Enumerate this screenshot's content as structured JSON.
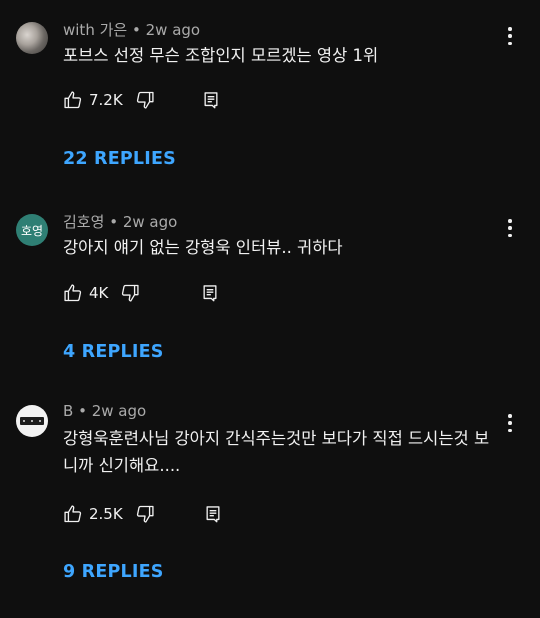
{
  "comments": [
    {
      "author": "with 가은",
      "age": "2w ago",
      "avatar_type": "photo",
      "text": "포브스 선정 무슨 조합인지 모르겠는 영상 1위",
      "likes": "7.2K",
      "replies_label": "22 REPLIES"
    },
    {
      "author": "김호영",
      "age": "2w ago",
      "avatar_type": "initials",
      "avatar_initials": "호영",
      "text": "강아지 얘기 없는 강형욱 인터뷰.. 귀하다",
      "likes": "4K",
      "replies_label": "4 REPLIES"
    },
    {
      "author": "B",
      "age": "2w ago",
      "avatar_type": "image",
      "text": "강형욱훈련사님 강아지 간식주는것만 보다가 직접 드시는것 보니까 신기해요....",
      "likes": "2.5K",
      "replies_label": "9 REPLIES"
    }
  ],
  "meta_separator": "•",
  "icons": {
    "like": "thumbs-up-icon",
    "dislike": "thumbs-down-icon",
    "reply": "reply-comment-icon",
    "more": "more-vertical-icon"
  },
  "colors": {
    "background": "#0f0f0f",
    "text": "#f1f1f1",
    "secondary_text": "#aaaaaa",
    "link": "#3ea6ff",
    "avatar_initials_bg": "#2f7f74"
  }
}
